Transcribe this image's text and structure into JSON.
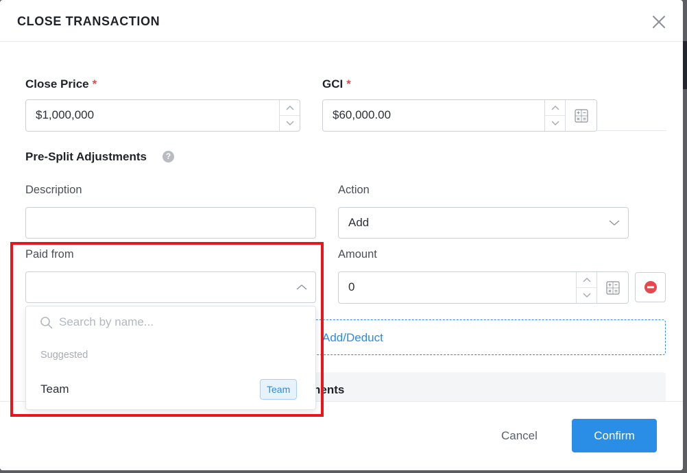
{
  "dialog": {
    "title": "CLOSE TRANSACTION"
  },
  "close_price": {
    "label": "Close Price",
    "required_mark": "*",
    "value": "$1,000,000"
  },
  "gci": {
    "label": "GCI",
    "required_mark": "*",
    "value": "$60,000.00"
  },
  "pre_split": {
    "heading": "Pre-Split Adjustments",
    "help_glyph": "?",
    "description_label": "Description",
    "description_value": "",
    "action_label": "Action",
    "action_value": "Add",
    "paid_from_label": "Paid from",
    "paid_from_value": "",
    "amount_label": "Amount",
    "amount_value": "0",
    "add_deduct_label": "Add/Deduct",
    "section_partial_heading": "nents"
  },
  "dropdown": {
    "search_placeholder": "Search by name...",
    "group_label": "Suggested",
    "options": [
      {
        "label": "Team",
        "badge": "Team"
      }
    ]
  },
  "footer": {
    "cancel_label": "Cancel",
    "confirm_label": "Confirm"
  },
  "colors": {
    "accent": "#2b8ee6",
    "required": "#e5484d",
    "highlight_box": "#e8161b",
    "remove_icon": "#e5484d"
  },
  "icons": [
    "close-icon",
    "chevron-up-icon",
    "chevron-down-icon",
    "calculator-icon",
    "help-icon",
    "search-icon",
    "remove-icon"
  ]
}
